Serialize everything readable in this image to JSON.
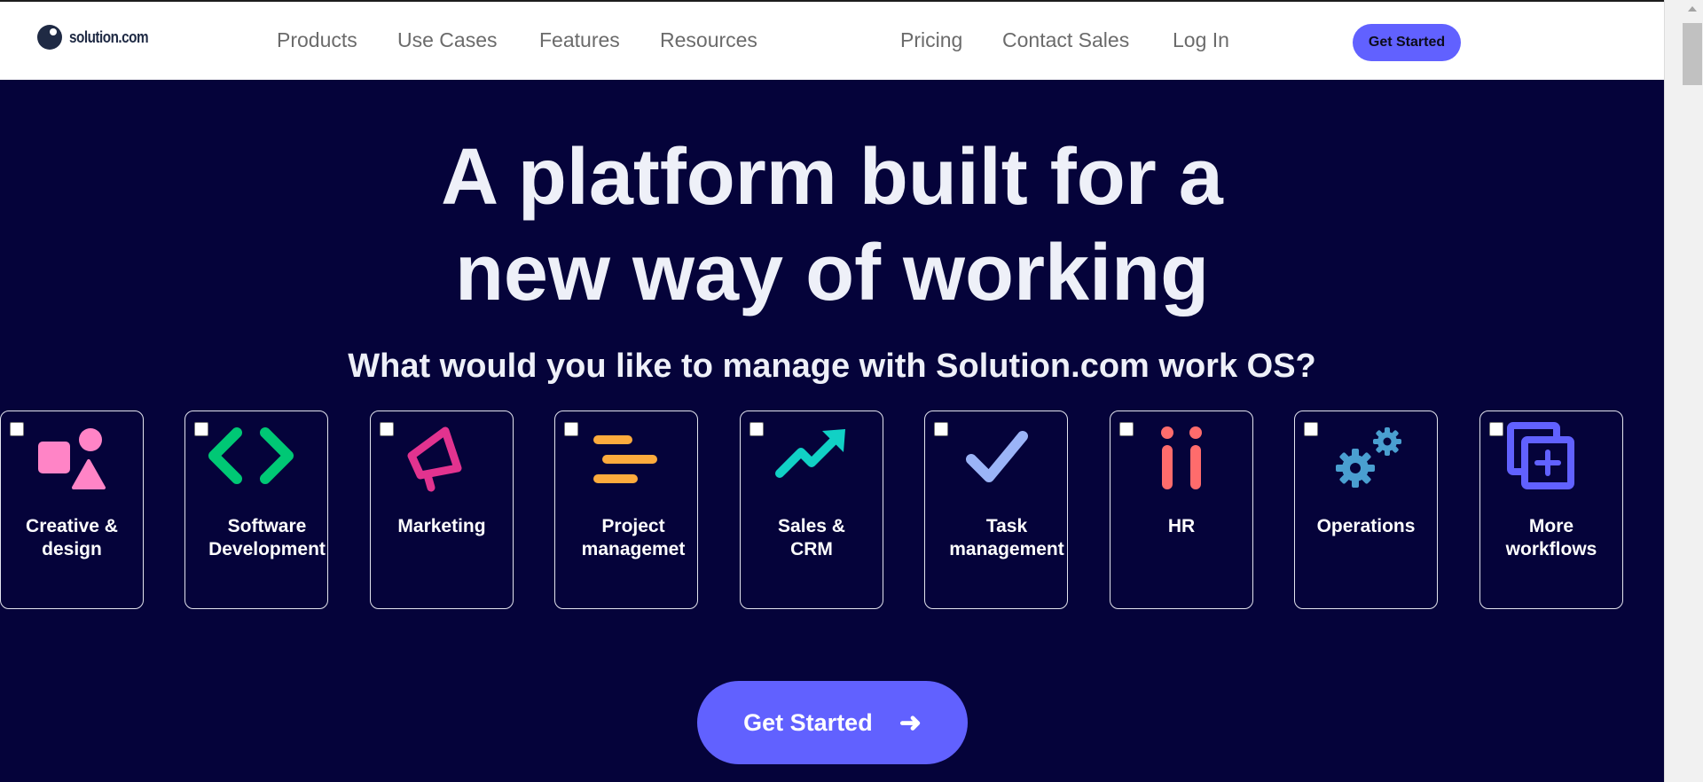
{
  "header": {
    "logo_text": "solution.com",
    "nav": [
      "Products",
      "Use Cases",
      "Features",
      "Resources",
      "Pricing",
      "Contact Sales",
      "Log In"
    ],
    "cta_label": "Get Started"
  },
  "hero": {
    "title_line1": "A platform built for a",
    "title_line2": "new way of working",
    "subtitle": "What would you like to manage with Solution.com work OS?",
    "cards": [
      {
        "label_line1": "Creative &",
        "label_line2": "design",
        "icon": "shapes-icon",
        "color": "#ff84c6"
      },
      {
        "label_line1": "Software",
        "label_line2": "Development",
        "icon": "code-brackets-icon",
        "color": "#00c875"
      },
      {
        "label_line1": "Marketing",
        "label_line2": "",
        "icon": "megaphone-icon",
        "color": "#e2338f"
      },
      {
        "label_line1": "Project",
        "label_line2": "managemet",
        "icon": "gantt-bars-icon",
        "color": "#fdab3d"
      },
      {
        "label_line1": "Sales &",
        "label_line2": "CRM",
        "icon": "trending-up-icon",
        "color": "#11d1c5"
      },
      {
        "label_line1": "Task",
        "label_line2": "management",
        "icon": "checkmark-icon",
        "color": "#9bb4f7"
      },
      {
        "label_line1": "HR",
        "label_line2": "",
        "icon": "people-icon",
        "color": "#ff6c6c"
      },
      {
        "label_line1": "Operations",
        "label_line2": "",
        "icon": "gears-icon",
        "color": "#4a9fd0"
      },
      {
        "label_line1": "More",
        "label_line2": "workflows",
        "icon": "add-window-icon",
        "color": "#6161ff"
      }
    ],
    "cta_label": "Get Started",
    "cta_arrow": "➜"
  },
  "colors": {
    "hero_background": "#05033a",
    "brand": "#6161ff"
  }
}
